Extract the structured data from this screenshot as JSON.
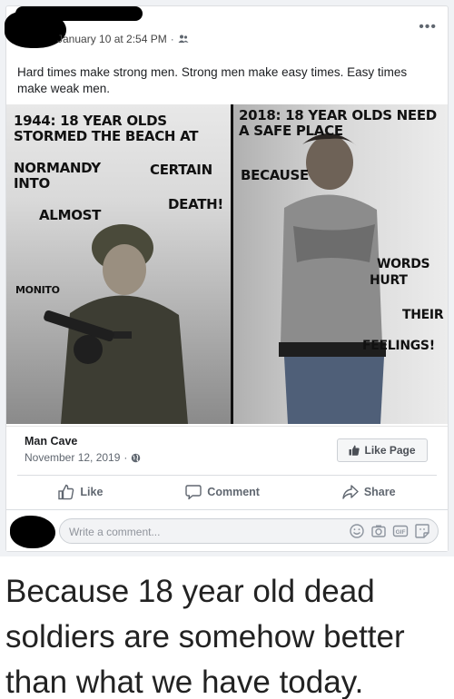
{
  "post": {
    "timestamp": "January 10 at 2:54 PM",
    "audience_icon": "friends-icon",
    "more_label": "•••",
    "text": "Hard times make strong men. Strong men make easy times. Easy times make weak men."
  },
  "meme": {
    "left": {
      "line1": "1944: 18 year olds stormed the beach at",
      "line2": "Normandy into",
      "line3": "almost",
      "line4": "certain",
      "line5": "death!",
      "watermark": "MONITO"
    },
    "right": {
      "line1": "2018: 18 year olds need a safe place",
      "line2": "because",
      "line3": "words",
      "line4": "hurt",
      "line5": "their",
      "line6": "feelings!"
    }
  },
  "page": {
    "name": "Man Cave",
    "date": "November 12, 2019",
    "like_page_label": "Like Page"
  },
  "actions": {
    "like": "Like",
    "comment": "Comment",
    "share": "Share"
  },
  "comment": {
    "placeholder": "Write a comment..."
  },
  "caption": "Because 18 year old dead soldiers are somehow better than what we have today."
}
